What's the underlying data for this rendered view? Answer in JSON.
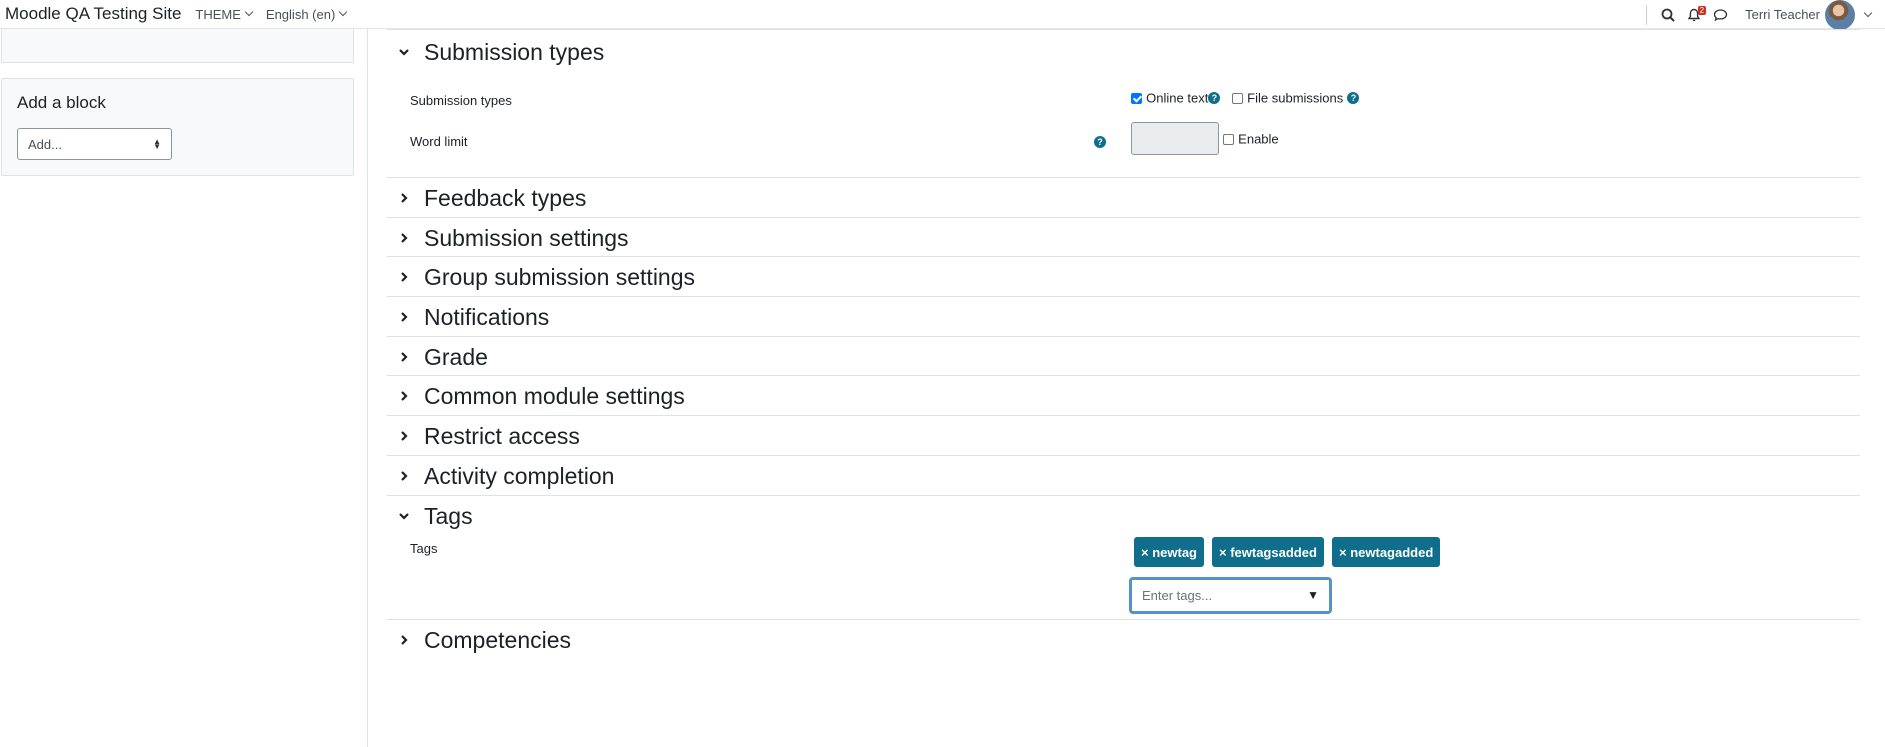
{
  "navbar": {
    "site_name": "Moodle QA Testing Site",
    "theme_menu": "THEME",
    "language_menu": "English (en)",
    "notification_count": "2",
    "user_name": "Terri Teacher"
  },
  "sidebar": {
    "add_block_title": "Add a block",
    "add_block_select": "Add..."
  },
  "sections": {
    "submission_types": {
      "title": "Submission types",
      "row_label": "Submission types",
      "online_text": "Online text",
      "online_text_checked": true,
      "file_submissions": "File submissions",
      "file_submissions_checked": false,
      "word_limit_label": "Word limit",
      "word_limit_value": "",
      "enable_label": "Enable"
    },
    "feedback_types": "Feedback types",
    "submission_settings": "Submission settings",
    "group_submission_settings": "Group submission settings",
    "notifications": "Notifications",
    "grade": "Grade",
    "common_module_settings": "Common module settings",
    "restrict_access": "Restrict access",
    "activity_completion": "Activity completion",
    "tags": {
      "title": "Tags",
      "row_label": "Tags",
      "items": [
        "× newtag",
        "× fewtagsadded",
        "× newtagadded"
      ],
      "placeholder": "Enter tags...",
      "arrow": "▼"
    },
    "competencies": "Competencies"
  },
  "colors": {
    "accent": "#0f6e8c",
    "focus_border": "#5691c8",
    "badge": "#ca3120"
  }
}
